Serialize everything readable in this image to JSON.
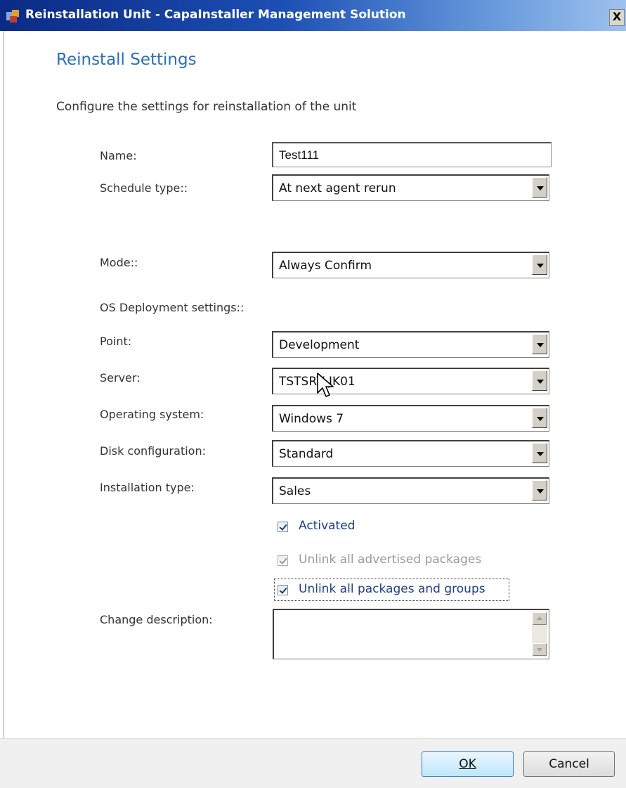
{
  "window": {
    "title": "Reinstallation Unit - CapaInstaller Management Solution",
    "close_label": "X"
  },
  "header": {
    "heading": "Reinstall Settings",
    "subheading": "Configure the settings for reinstallation of the unit"
  },
  "form": {
    "name": {
      "label": "Name:",
      "value": "Test111"
    },
    "schedule_type": {
      "label": "Schedule type::",
      "value": "At next agent rerun"
    },
    "mode": {
      "label": "Mode::",
      "value": "Always Confirm"
    },
    "os_section_label": "OS Deployment settings::",
    "point": {
      "label": "Point:",
      "value": "Development"
    },
    "server": {
      "label": "Server:",
      "value": "TSTSRV-JK01"
    },
    "operating_system": {
      "label": "Operating system:",
      "value": "Windows 7"
    },
    "disk_configuration": {
      "label": "Disk configuration:",
      "value": "Standard"
    },
    "installation_type": {
      "label": "Installation type:",
      "value": "Sales"
    },
    "activated": {
      "label": "Activated",
      "checked": true
    },
    "unlink_advertised": {
      "label": "Unlink all advertised packages",
      "checked": true,
      "disabled": true
    },
    "unlink_all": {
      "label": "Unlink all packages and groups",
      "checked": true
    },
    "change_description": {
      "label": "Change description:",
      "value": ""
    }
  },
  "footer": {
    "ok_label": "OK",
    "cancel_label": "Cancel"
  }
}
